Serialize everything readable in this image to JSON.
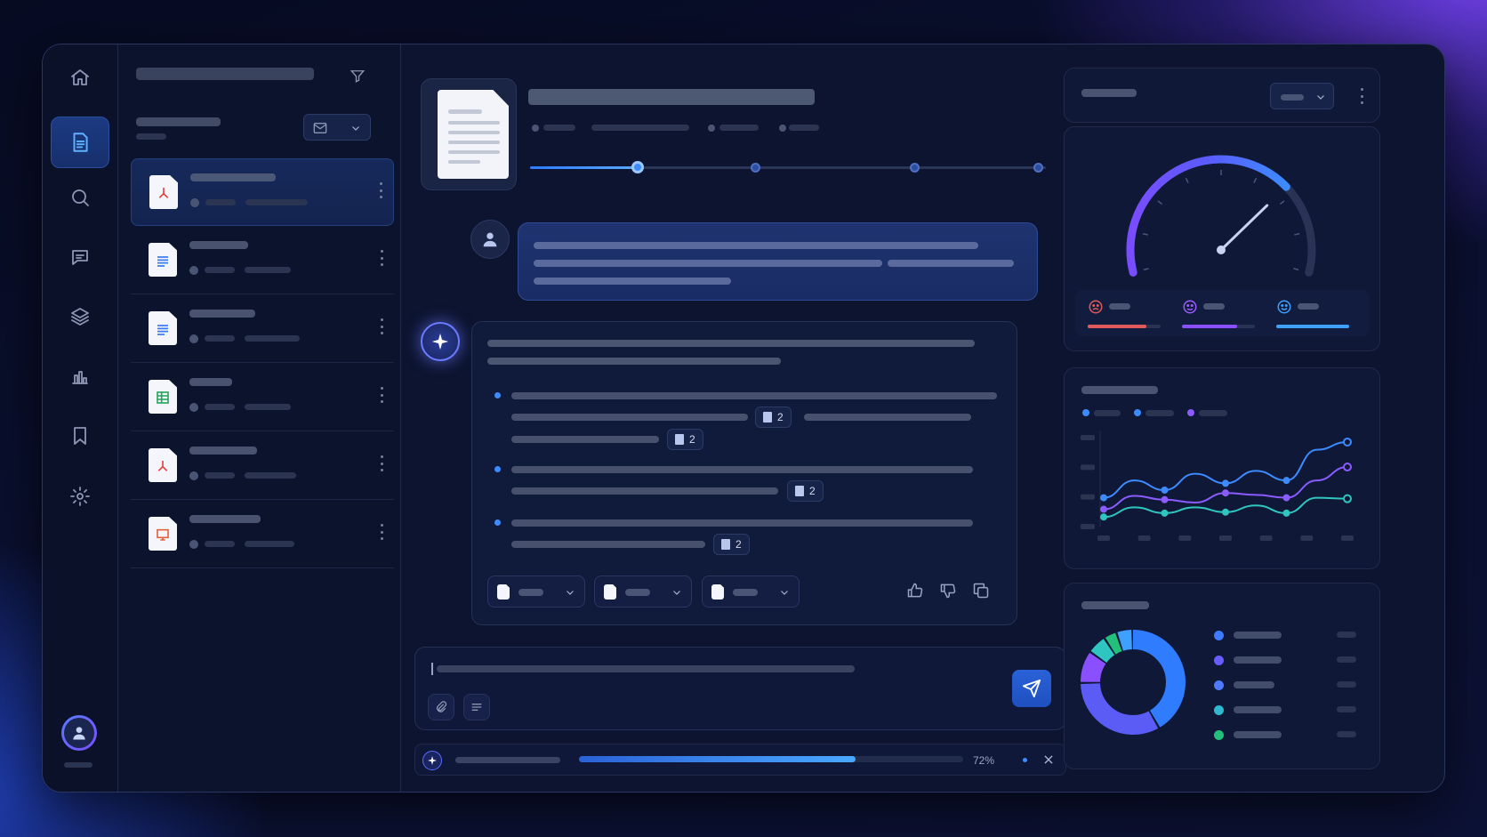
{
  "citations": {
    "c1": "2",
    "c2": "2",
    "c3": "2",
    "c4": "2"
  },
  "progress": {
    "percent_label": "72%",
    "value": 0.72
  },
  "colors": {
    "accent": "#3d8bff",
    "purple": "#7a5cff",
    "teal": "#2fd0c0",
    "green": "#22c07a",
    "red": "#e05a5a",
    "bg": "#0c1430"
  },
  "sidebar": {
    "icons": [
      "home-icon",
      "documents-icon",
      "search-icon",
      "chat-icon",
      "layers-icon",
      "analytics-icon",
      "bookmark-icon",
      "settings-icon"
    ],
    "active": "documents-icon"
  },
  "documents": [
    {
      "type": "pdf",
      "selected": true
    },
    {
      "type": "doc"
    },
    {
      "type": "doc"
    },
    {
      "type": "sheet"
    },
    {
      "type": "pdf"
    },
    {
      "type": "slides"
    }
  ],
  "gauge": {
    "needle_fraction": 0.72
  },
  "line_chart": {
    "series": [
      {
        "color": "#3d8bff",
        "values": [
          0.3,
          0.48,
          0.38,
          0.55,
          0.45,
          0.58,
          0.48,
          0.8,
          0.88
        ]
      },
      {
        "color": "#8a5cff",
        "values": [
          0.18,
          0.32,
          0.28,
          0.25,
          0.35,
          0.33,
          0.3,
          0.48,
          0.62
        ]
      },
      {
        "color": "#2fc5c0",
        "values": [
          0.1,
          0.2,
          0.14,
          0.2,
          0.15,
          0.22,
          0.14,
          0.3,
          0.29
        ]
      }
    ]
  },
  "donut": {
    "segments": [
      {
        "color": "#2f7cff",
        "value": 0.42
      },
      {
        "color": "#5b5cf5",
        "value": 0.33
      },
      {
        "color": "#8a4fff",
        "value": 0.1
      },
      {
        "color": "#2fc5c0",
        "value": 0.06
      },
      {
        "color": "#22c07a",
        "value": 0.04
      },
      {
        "color": "#3ea0ff",
        "value": 0.05
      }
    ],
    "legend_colors": [
      "#3d7bff",
      "#6a5cff",
      "#4f7aff",
      "#2fb8d0",
      "#22c07a"
    ]
  }
}
